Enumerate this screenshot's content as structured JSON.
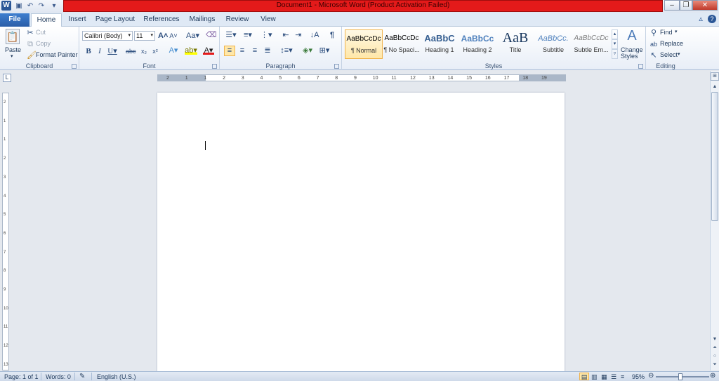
{
  "window": {
    "title": "Document1 - Microsoft Word (Product Activation Failed)",
    "app_icon": "W",
    "title_bar_color": "#e41a1a"
  },
  "tabs": [
    {
      "label": "File"
    },
    {
      "label": "Home"
    },
    {
      "label": "Insert"
    },
    {
      "label": "Page Layout"
    },
    {
      "label": "References"
    },
    {
      "label": "Mailings"
    },
    {
      "label": "Review"
    },
    {
      "label": "View"
    }
  ],
  "clipboard": {
    "paste": "Paste",
    "cut": "Cut",
    "copy": "Copy",
    "format_painter": "Format Painter",
    "label": "Clipboard"
  },
  "font": {
    "name": "Calibri (Body)",
    "size": "11",
    "label": "Font"
  },
  "paragraph": {
    "label": "Paragraph"
  },
  "styles": {
    "label": "Styles",
    "items": [
      {
        "preview": "AaBbCcDc",
        "name": "¶ Normal"
      },
      {
        "preview": "AaBbCcDc",
        "name": "¶ No Spaci..."
      },
      {
        "preview": "AaBbC",
        "name": "Heading 1"
      },
      {
        "preview": "AaBbCc",
        "name": "Heading 2"
      },
      {
        "preview": "AaB",
        "name": "Title"
      },
      {
        "preview": "AaBbCc.",
        "name": "Subtitle"
      },
      {
        "preview": "AaBbCcDc",
        "name": "Subtle Em..."
      }
    ],
    "change_styles_1": "Change",
    "change_styles_2": "Styles"
  },
  "editing": {
    "find": "Find",
    "replace": "Replace",
    "select": "Select",
    "label": "Editing"
  },
  "ruler": {
    "numbers": [
      "2",
      "1",
      "1",
      "2",
      "3",
      "4",
      "5",
      "6",
      "7",
      "8",
      "9",
      "10",
      "11",
      "12",
      "13",
      "14",
      "15",
      "16",
      "17",
      "18",
      "19"
    ],
    "vnumbers": [
      "2",
      "1",
      "1",
      "2",
      "3",
      "4",
      "5",
      "6",
      "7",
      "8",
      "9",
      "10",
      "11",
      "12",
      "13"
    ]
  },
  "status": {
    "page": "Page: 1 of 1",
    "words": "Words: 0",
    "language": "English (U.S.)",
    "zoom": "95%"
  }
}
